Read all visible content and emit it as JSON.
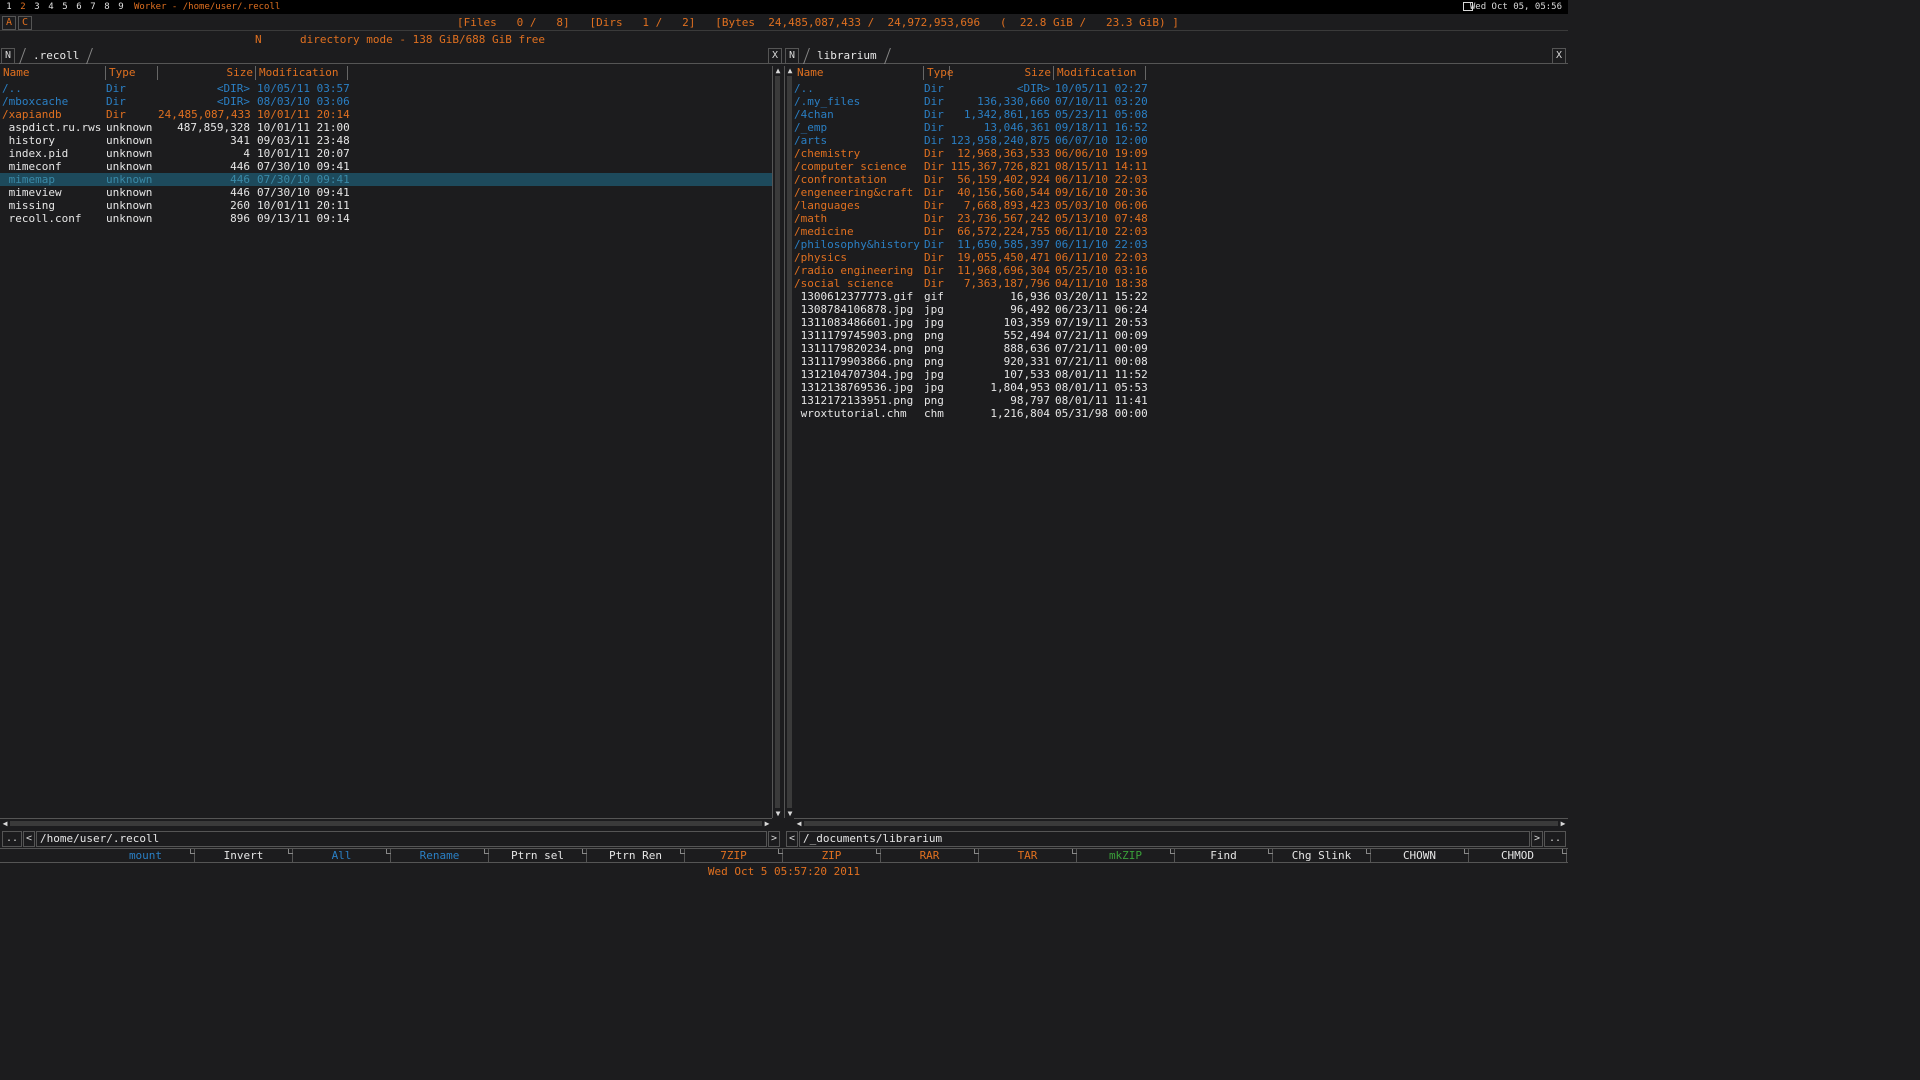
{
  "topbar": {
    "workspaces": [
      "1",
      "2",
      "3",
      "4",
      "5",
      "6",
      "7",
      "8",
      "9"
    ],
    "active_workspace": "2",
    "window_title": "Worker - /home/user/.recoll",
    "clock": "Wed Oct 05, 05:56"
  },
  "status": {
    "btn_a": "A",
    "btn_c": "C",
    "stats": "[Files   0 /   8]   [Dirs   1 /   2]   [Bytes  24,485,087,433 /  24,972,953,696   (  22.8 GiB /   23.3 GiB) ]",
    "mode_key": "N",
    "mode_text": "directory mode - 138 GiB/688 GiB free"
  },
  "left": {
    "new_tab": "N",
    "tab_label": ".recoll",
    "close": "X",
    "headers": {
      "name": "Name",
      "type": "Type",
      "size": "Size",
      "mod": "Modification"
    },
    "rows": [
      {
        "name": "/..",
        "type": "Dir",
        "size": "<DIR>",
        "mod": "10/05/11 03:57",
        "style": "dir"
      },
      {
        "name": "/mboxcache",
        "type": "Dir",
        "size": "<DIR>",
        "mod": "08/03/10 03:06",
        "style": "dir"
      },
      {
        "name": "/xapiandb",
        "type": "Dir",
        "size": "24,485,087,433",
        "mod": "10/01/11 20:14",
        "style": "orange"
      },
      {
        "name": " aspdict.ru.rws",
        "type": "unknown",
        "size": "487,859,328",
        "mod": "10/01/11 21:00",
        "style": "white"
      },
      {
        "name": " history",
        "type": "unknown",
        "size": "341",
        "mod": "09/03/11 23:48",
        "style": "white"
      },
      {
        "name": " index.pid",
        "type": "unknown",
        "size": "4",
        "mod": "10/01/11 20:07",
        "style": "white"
      },
      {
        "name": " mimeconf",
        "type": "unknown",
        "size": "446",
        "mod": "07/30/10 09:41",
        "style": "white"
      },
      {
        "name": " mimemap",
        "type": "unknown",
        "size": "446",
        "mod": "07/30/10 09:41",
        "style": "sel"
      },
      {
        "name": " mimeview",
        "type": "unknown",
        "size": "446",
        "mod": "07/30/10 09:41",
        "style": "white"
      },
      {
        "name": " missing",
        "type": "unknown",
        "size": "260",
        "mod": "10/01/11 20:11",
        "style": "white"
      },
      {
        "name": " recoll.conf",
        "type": "unknown",
        "size": "896",
        "mod": "09/13/11 09:14",
        "style": "white"
      }
    ],
    "path": "/home/user/.recoll",
    "nav_up": "..",
    "nav_prev": "<",
    "nav_next": ">"
  },
  "right": {
    "new_tab": "N",
    "tab_label": "librarium",
    "close": "X",
    "headers": {
      "name": "Name",
      "type": "Type",
      "size": "Size",
      "mod": "Modification"
    },
    "rows": [
      {
        "name": "/..",
        "type": "Dir",
        "size": "<DIR>",
        "mod": "10/05/11 02:27",
        "style": "dir"
      },
      {
        "name": "/.my_files",
        "type": "Dir",
        "size": "136,330,660",
        "mod": "07/10/11 03:20",
        "style": "dir"
      },
      {
        "name": "/4chan",
        "type": "Dir",
        "size": "1,342,861,165",
        "mod": "05/23/11 05:08",
        "style": "dir"
      },
      {
        "name": "/_emp",
        "type": "Dir",
        "size": "13,046,361",
        "mod": "09/18/11 16:52",
        "style": "dir"
      },
      {
        "name": "/arts",
        "type": "Dir",
        "size": "123,958,240,875",
        "mod": "06/07/10 12:00",
        "style": "dir"
      },
      {
        "name": "/chemistry",
        "type": "Dir",
        "size": "12,968,363,533",
        "mod": "06/06/10 19:09",
        "style": "orange"
      },
      {
        "name": "/computer science",
        "type": "Dir",
        "size": "115,367,726,821",
        "mod": "08/15/11 14:11",
        "style": "orange"
      },
      {
        "name": "/confrontation",
        "type": "Dir",
        "size": "56,159,402,924",
        "mod": "06/11/10 22:03",
        "style": "orange"
      },
      {
        "name": "/engeneering&craft",
        "type": "Dir",
        "size": "40,156,560,544",
        "mod": "09/16/10 20:36",
        "style": "orange"
      },
      {
        "name": "/languages",
        "type": "Dir",
        "size": "7,668,893,423",
        "mod": "05/03/10 06:06",
        "style": "orange"
      },
      {
        "name": "/math",
        "type": "Dir",
        "size": "23,736,567,242",
        "mod": "05/13/10 07:48",
        "style": "orange"
      },
      {
        "name": "/medicine",
        "type": "Dir",
        "size": "66,572,224,755",
        "mod": "06/11/10 22:03",
        "style": "orange"
      },
      {
        "name": "/philosophy&history",
        "type": "Dir",
        "size": "11,650,585,397",
        "mod": "06/11/10 22:03",
        "style": "dir"
      },
      {
        "name": "/physics",
        "type": "Dir",
        "size": "19,055,450,471",
        "mod": "06/11/10 22:03",
        "style": "orange"
      },
      {
        "name": "/radio engineering",
        "type": "Dir",
        "size": "11,968,696,304",
        "mod": "05/25/10 03:16",
        "style": "orange"
      },
      {
        "name": "/social science",
        "type": "Dir",
        "size": "7,363,187,796",
        "mod": "04/11/10 18:38",
        "style": "orange"
      },
      {
        "name": " 1300612377773.gif",
        "type": "gif",
        "size": "16,936",
        "mod": "03/20/11 15:22",
        "style": "white"
      },
      {
        "name": " 1308784106878.jpg",
        "type": "jpg",
        "size": "96,492",
        "mod": "06/23/11 06:24",
        "style": "white"
      },
      {
        "name": " 1311083486601.jpg",
        "type": "jpg",
        "size": "103,359",
        "mod": "07/19/11 20:53",
        "style": "white"
      },
      {
        "name": " 1311179745903.png",
        "type": "png",
        "size": "552,494",
        "mod": "07/21/11 00:09",
        "style": "white"
      },
      {
        "name": " 1311179820234.png",
        "type": "png",
        "size": "888,636",
        "mod": "07/21/11 00:09",
        "style": "white"
      },
      {
        "name": " 1311179903866.png",
        "type": "png",
        "size": "920,331",
        "mod": "07/21/11 00:08",
        "style": "white"
      },
      {
        "name": " 1312104707304.jpg",
        "type": "jpg",
        "size": "107,533",
        "mod": "08/01/11 11:52",
        "style": "white"
      },
      {
        "name": " 1312138769536.jpg",
        "type": "jpg",
        "size": "1,804,953",
        "mod": "08/01/11 05:53",
        "style": "white"
      },
      {
        "name": " 1312172133951.png",
        "type": "png",
        "size": "98,797",
        "mod": "08/01/11 11:41",
        "style": "white"
      },
      {
        "name": " wroxtutorial.chm",
        "type": "chm",
        "size": "1,216,804",
        "mod": "05/31/98 00:00",
        "style": "white"
      }
    ],
    "path": "/_documents/librarium",
    "nav_up": "..",
    "nav_prev": "<",
    "nav_next": ">"
  },
  "buttons": [
    {
      "label": "mount",
      "color": "#2a7fc4"
    },
    {
      "label": "Invert",
      "color": "#e6e6e6"
    },
    {
      "label": "All",
      "color": "#2a7fc4"
    },
    {
      "label": "Rename",
      "color": "#2a7fc4"
    },
    {
      "label": "Ptrn sel",
      "color": "#e6e6e6"
    },
    {
      "label": "Ptrn Ren",
      "color": "#e6e6e6"
    },
    {
      "label": "7ZIP",
      "color": "#e07020"
    },
    {
      "label": "ZIP",
      "color": "#e07020"
    },
    {
      "label": "RAR",
      "color": "#e07020"
    },
    {
      "label": "TAR",
      "color": "#e07020"
    },
    {
      "label": "mkZIP",
      "color": "#3aa03a"
    },
    {
      "label": "Find",
      "color": "#e6e6e6"
    },
    {
      "label": "Chg Slink",
      "color": "#e6e6e6"
    },
    {
      "label": "CHOWN",
      "color": "#e6e6e6"
    },
    {
      "label": "CHMOD",
      "color": "#e6e6e6"
    }
  ],
  "bottom_clock": "Wed Oct  5 05:57:20 2011"
}
